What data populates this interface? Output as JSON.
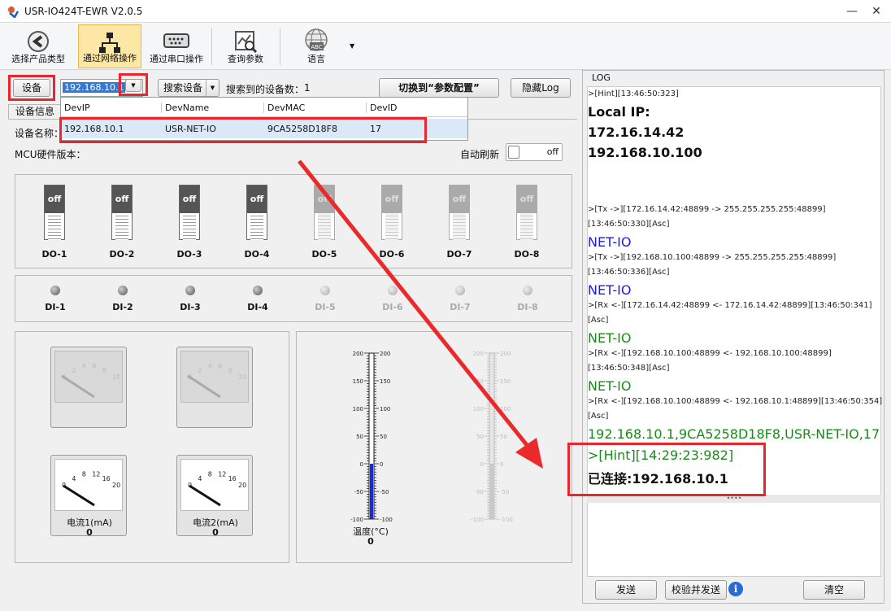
{
  "window": {
    "title": "USR-IO424T-EWR V2.0.5",
    "min": "—",
    "close": "✕"
  },
  "toolbar": {
    "items": [
      {
        "label": "选择产品类型",
        "icon": "back-arrow-icon"
      },
      {
        "label": "通过网络操作",
        "icon": "network-icon"
      },
      {
        "label": "通过串口操作",
        "icon": "serial-port-icon"
      },
      {
        "label": "查询参数",
        "icon": "query-chart-icon"
      },
      {
        "label": "语言",
        "icon": "globe-language-icon"
      }
    ]
  },
  "device_bar": {
    "device_btn": "设备",
    "ip_value": "192.168.10.1",
    "search_btn": "搜索设备",
    "found_label": "搜索到的设备数：",
    "found_count": "1",
    "switch_btn": "切换到“参数配置”",
    "hide_log_btn": "隐藏Log"
  },
  "dropdown": {
    "headers": [
      "DevIP",
      "DevName",
      "DevMAC",
      "DevID"
    ],
    "rows": [
      [
        "192.168.10.1",
        "USR-NET-IO",
        "9CA5258D18F8",
        "17"
      ]
    ]
  },
  "device_info": {
    "tab": "设备信息",
    "name_label": "设备名称：",
    "mcu_label": "MCU硬件版本：",
    "auto_refresh": "自动刷新",
    "toggle": "off"
  },
  "do_switches": [
    {
      "label": "DO-1",
      "state": "off",
      "enabled": true
    },
    {
      "label": "DO-2",
      "state": "off",
      "enabled": true
    },
    {
      "label": "DO-3",
      "state": "off",
      "enabled": true
    },
    {
      "label": "DO-4",
      "state": "off",
      "enabled": true
    },
    {
      "label": "DO-5",
      "state": "off",
      "enabled": false
    },
    {
      "label": "DO-6",
      "state": "off",
      "enabled": false
    },
    {
      "label": "DO-7",
      "state": "off",
      "enabled": false
    },
    {
      "label": "DO-8",
      "state": "off",
      "enabled": false
    }
  ],
  "di_inputs": [
    {
      "label": "DI-1",
      "enabled": true
    },
    {
      "label": "DI-2",
      "enabled": true
    },
    {
      "label": "DI-3",
      "enabled": true
    },
    {
      "label": "DI-4",
      "enabled": true
    },
    {
      "label": "DI-5",
      "enabled": false
    },
    {
      "label": "DI-6",
      "enabled": false
    },
    {
      "label": "DI-7",
      "enabled": false
    },
    {
      "label": "DI-8",
      "enabled": false
    }
  ],
  "gauges": {
    "disabled_ticks": [
      "0",
      "2",
      "4",
      "6",
      "8",
      "10"
    ],
    "current_ticks": [
      "0",
      "4",
      "8",
      "12",
      "16",
      "20"
    ],
    "current1": {
      "label": "电流1(mA)",
      "value": "0"
    },
    "current2": {
      "label": "电流2(mA)",
      "value": "0"
    }
  },
  "thermometer": {
    "ticks": [
      "200",
      "150",
      "100",
      "50",
      "0",
      "-50",
      "-100"
    ],
    "label": "温度(°C)",
    "value": "0"
  },
  "log": {
    "title": "LOG",
    "lines": [
      ">[Hint][13:46:50:323]",
      "Local IP:",
      "172.16.14.42",
      "192.168.10.100",
      ">[Tx ->][172.16.14.42:48899 -> 255.255.255.255:48899]",
      "[13:46:50:330][Asc]",
      "NET-IO",
      ">[Tx ->][192.168.10.100:48899 -> 255.255.255.255:48899]",
      "[13:46:50:336][Asc]",
      "NET-IO",
      ">[Rx <-][172.16.14.42:48899 <- 172.16.14.42:48899][13:46:50:341]",
      "[Asc]",
      "NET-IO",
      ">[Rx <-][192.168.10.100:48899 <- 192.168.10.100:48899]",
      "[13:46:50:348][Asc]",
      "NET-IO",
      ">[Rx <-][192.168.10.100:48899 <- 192.168.10.1:48899][13:46:50:354]",
      "[Asc]",
      "192.168.10.1,9CA5258D18F8,USR-NET-IO,17",
      ">[Hint][14:29:23:982]",
      "已连接:192.168.10.1"
    ],
    "send_btn": "发送",
    "verify_send_btn": "校验并发送",
    "clear_btn": "清空"
  }
}
